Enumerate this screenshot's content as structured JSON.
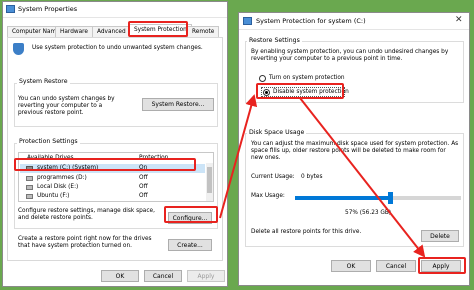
{
  "system_properties": {
    "title": "System Properties",
    "tabs": [
      "Computer Name",
      "Hardware",
      "Advanced",
      "System Protection",
      "Remote"
    ],
    "intro": "Use system protection to undo unwanted system changes.",
    "restore_title": "System Restore",
    "restore_desc": "You can undo system changes by reverting your computer to a previous restore point.",
    "restore_button": "System Restore...",
    "protection_title": "Protection Settings",
    "col_drives": "Available Drives",
    "col_protection": "Protection",
    "drives": [
      {
        "name": "system (C:) (System)",
        "protection": "On"
      },
      {
        "name": "programmes (D:)",
        "protection": "Off"
      },
      {
        "name": "Local Disk (E:)",
        "protection": "Off"
      },
      {
        "name": "Ubuntu (F:)",
        "protection": "Off"
      }
    ],
    "configure_desc": "Configure restore settings, manage disk space, and delete restore points.",
    "configure_button": "Configure...",
    "create_desc": "Create a restore point right now for the drives that have system protection turned on.",
    "create_button": "Create...",
    "ok": "OK",
    "cancel": "Cancel",
    "apply": "Apply"
  },
  "protection_dialog": {
    "title": "System Protection for system (C:)",
    "restore_settings_title": "Restore Settings",
    "restore_settings_desc": "By enabling system protection, you can undo undesired changes by reverting your computer to a previous point in time.",
    "option_on": "Turn on system protection",
    "option_off": "Disable system protection",
    "disk_title": "Disk Space Usage",
    "disk_desc": "You can adjust the maximum disk space used for system protection. As space fills up, older restore points will be deleted to make room for new ones.",
    "current_usage_label": "Current Usage:",
    "current_usage_value": "0 bytes",
    "max_usage_label": "Max Usage:",
    "slider_value": "57% (56.23 GB)",
    "slider_fraction": 0.57,
    "delete_desc": "Delete all restore points for this drive.",
    "delete_button": "Delete",
    "ok": "OK",
    "cancel": "Cancel",
    "apply": "Apply"
  },
  "colors": {
    "background": "#6aa84f",
    "highlight": "#e8231f",
    "selection": "#cce4f7",
    "accent": "#0078d7"
  }
}
